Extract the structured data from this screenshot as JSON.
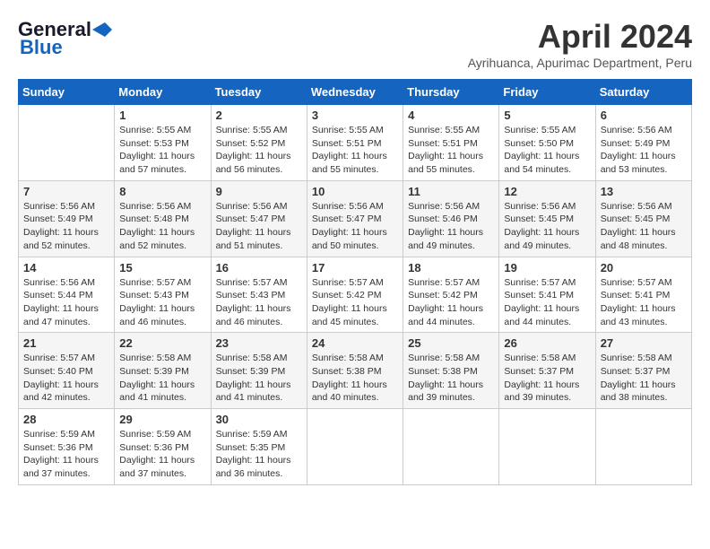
{
  "header": {
    "logo_general": "General",
    "logo_blue": "Blue",
    "month_year": "April 2024",
    "location": "Ayrihuanca, Apurimac Department, Peru"
  },
  "calendar": {
    "weekdays": [
      "Sunday",
      "Monday",
      "Tuesday",
      "Wednesday",
      "Thursday",
      "Friday",
      "Saturday"
    ],
    "weeks": [
      [
        {
          "day": "",
          "content": ""
        },
        {
          "day": "1",
          "content": "Sunrise: 5:55 AM\nSunset: 5:53 PM\nDaylight: 11 hours\nand 57 minutes."
        },
        {
          "day": "2",
          "content": "Sunrise: 5:55 AM\nSunset: 5:52 PM\nDaylight: 11 hours\nand 56 minutes."
        },
        {
          "day": "3",
          "content": "Sunrise: 5:55 AM\nSunset: 5:51 PM\nDaylight: 11 hours\nand 55 minutes."
        },
        {
          "day": "4",
          "content": "Sunrise: 5:55 AM\nSunset: 5:51 PM\nDaylight: 11 hours\nand 55 minutes."
        },
        {
          "day": "5",
          "content": "Sunrise: 5:55 AM\nSunset: 5:50 PM\nDaylight: 11 hours\nand 54 minutes."
        },
        {
          "day": "6",
          "content": "Sunrise: 5:56 AM\nSunset: 5:49 PM\nDaylight: 11 hours\nand 53 minutes."
        }
      ],
      [
        {
          "day": "7",
          "content": "Sunrise: 5:56 AM\nSunset: 5:49 PM\nDaylight: 11 hours\nand 52 minutes."
        },
        {
          "day": "8",
          "content": "Sunrise: 5:56 AM\nSunset: 5:48 PM\nDaylight: 11 hours\nand 52 minutes."
        },
        {
          "day": "9",
          "content": "Sunrise: 5:56 AM\nSunset: 5:47 PM\nDaylight: 11 hours\nand 51 minutes."
        },
        {
          "day": "10",
          "content": "Sunrise: 5:56 AM\nSunset: 5:47 PM\nDaylight: 11 hours\nand 50 minutes."
        },
        {
          "day": "11",
          "content": "Sunrise: 5:56 AM\nSunset: 5:46 PM\nDaylight: 11 hours\nand 49 minutes."
        },
        {
          "day": "12",
          "content": "Sunrise: 5:56 AM\nSunset: 5:45 PM\nDaylight: 11 hours\nand 49 minutes."
        },
        {
          "day": "13",
          "content": "Sunrise: 5:56 AM\nSunset: 5:45 PM\nDaylight: 11 hours\nand 48 minutes."
        }
      ],
      [
        {
          "day": "14",
          "content": "Sunrise: 5:56 AM\nSunset: 5:44 PM\nDaylight: 11 hours\nand 47 minutes."
        },
        {
          "day": "15",
          "content": "Sunrise: 5:57 AM\nSunset: 5:43 PM\nDaylight: 11 hours\nand 46 minutes."
        },
        {
          "day": "16",
          "content": "Sunrise: 5:57 AM\nSunset: 5:43 PM\nDaylight: 11 hours\nand 46 minutes."
        },
        {
          "day": "17",
          "content": "Sunrise: 5:57 AM\nSunset: 5:42 PM\nDaylight: 11 hours\nand 45 minutes."
        },
        {
          "day": "18",
          "content": "Sunrise: 5:57 AM\nSunset: 5:42 PM\nDaylight: 11 hours\nand 44 minutes."
        },
        {
          "day": "19",
          "content": "Sunrise: 5:57 AM\nSunset: 5:41 PM\nDaylight: 11 hours\nand 44 minutes."
        },
        {
          "day": "20",
          "content": "Sunrise: 5:57 AM\nSunset: 5:41 PM\nDaylight: 11 hours\nand 43 minutes."
        }
      ],
      [
        {
          "day": "21",
          "content": "Sunrise: 5:57 AM\nSunset: 5:40 PM\nDaylight: 11 hours\nand 42 minutes."
        },
        {
          "day": "22",
          "content": "Sunrise: 5:58 AM\nSunset: 5:39 PM\nDaylight: 11 hours\nand 41 minutes."
        },
        {
          "day": "23",
          "content": "Sunrise: 5:58 AM\nSunset: 5:39 PM\nDaylight: 11 hours\nand 41 minutes."
        },
        {
          "day": "24",
          "content": "Sunrise: 5:58 AM\nSunset: 5:38 PM\nDaylight: 11 hours\nand 40 minutes."
        },
        {
          "day": "25",
          "content": "Sunrise: 5:58 AM\nSunset: 5:38 PM\nDaylight: 11 hours\nand 39 minutes."
        },
        {
          "day": "26",
          "content": "Sunrise: 5:58 AM\nSunset: 5:37 PM\nDaylight: 11 hours\nand 39 minutes."
        },
        {
          "day": "27",
          "content": "Sunrise: 5:58 AM\nSunset: 5:37 PM\nDaylight: 11 hours\nand 38 minutes."
        }
      ],
      [
        {
          "day": "28",
          "content": "Sunrise: 5:59 AM\nSunset: 5:36 PM\nDaylight: 11 hours\nand 37 minutes."
        },
        {
          "day": "29",
          "content": "Sunrise: 5:59 AM\nSunset: 5:36 PM\nDaylight: 11 hours\nand 37 minutes."
        },
        {
          "day": "30",
          "content": "Sunrise: 5:59 AM\nSunset: 5:35 PM\nDaylight: 11 hours\nand 36 minutes."
        },
        {
          "day": "",
          "content": ""
        },
        {
          "day": "",
          "content": ""
        },
        {
          "day": "",
          "content": ""
        },
        {
          "day": "",
          "content": ""
        }
      ]
    ]
  }
}
